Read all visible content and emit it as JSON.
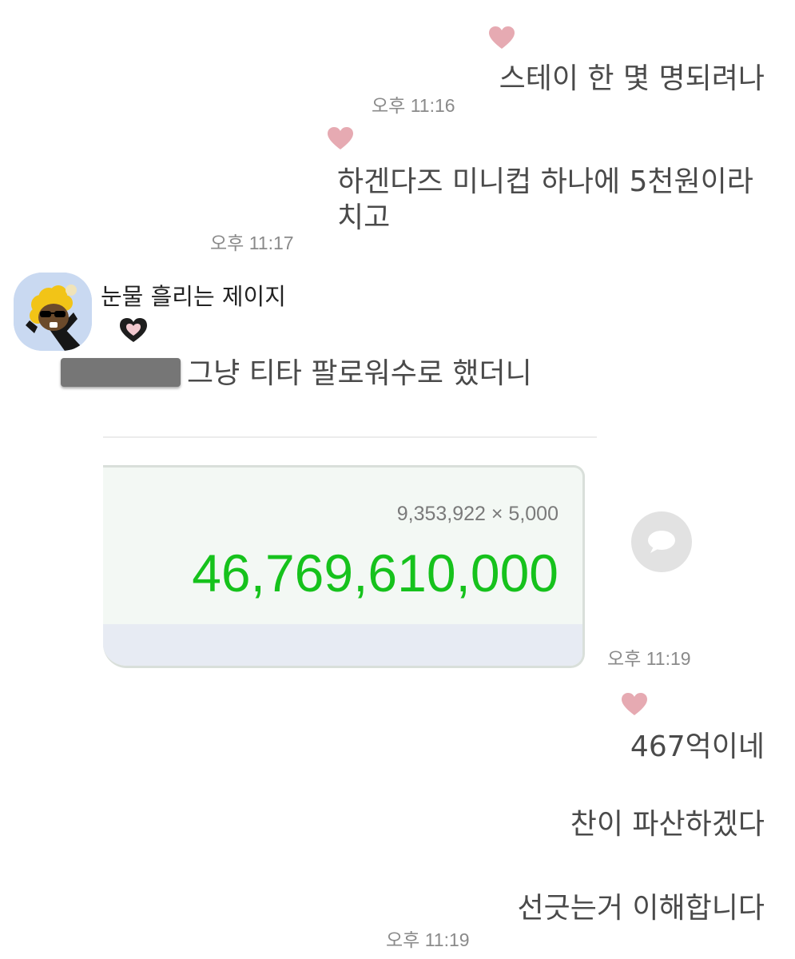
{
  "messages_top": [
    {
      "text": "스테이 한 몇 명되려나",
      "time": "오후 11:16"
    },
    {
      "line1": "하겐다즈 미니컵 하나에 5천원이라",
      "line2": "치고",
      "time": "오후 11:17"
    }
  ],
  "incoming": {
    "sender": "눈물 흘리는 제이지",
    "text": "그냥 티타 팔로워수로 했더니",
    "calc_expression": "9,353,922 × 5,000",
    "calc_result": "46,769,610,000",
    "time": "오후 11:19"
  },
  "messages_bottom": [
    {
      "text": "467억이네"
    },
    {
      "text": "찬이 파산하겠다"
    },
    {
      "text": "선긋는거 이해합니다"
    }
  ],
  "bottom_time": "오후 11:19",
  "colors": {
    "reaction_heart": "#e6aab2",
    "calc_green": "#16c21c",
    "avatar_bg": "#c9d9f1"
  },
  "icons": {
    "reaction": "heart-icon",
    "share": "speech-bubble-icon",
    "avatar": "character-avatar-icon"
  }
}
